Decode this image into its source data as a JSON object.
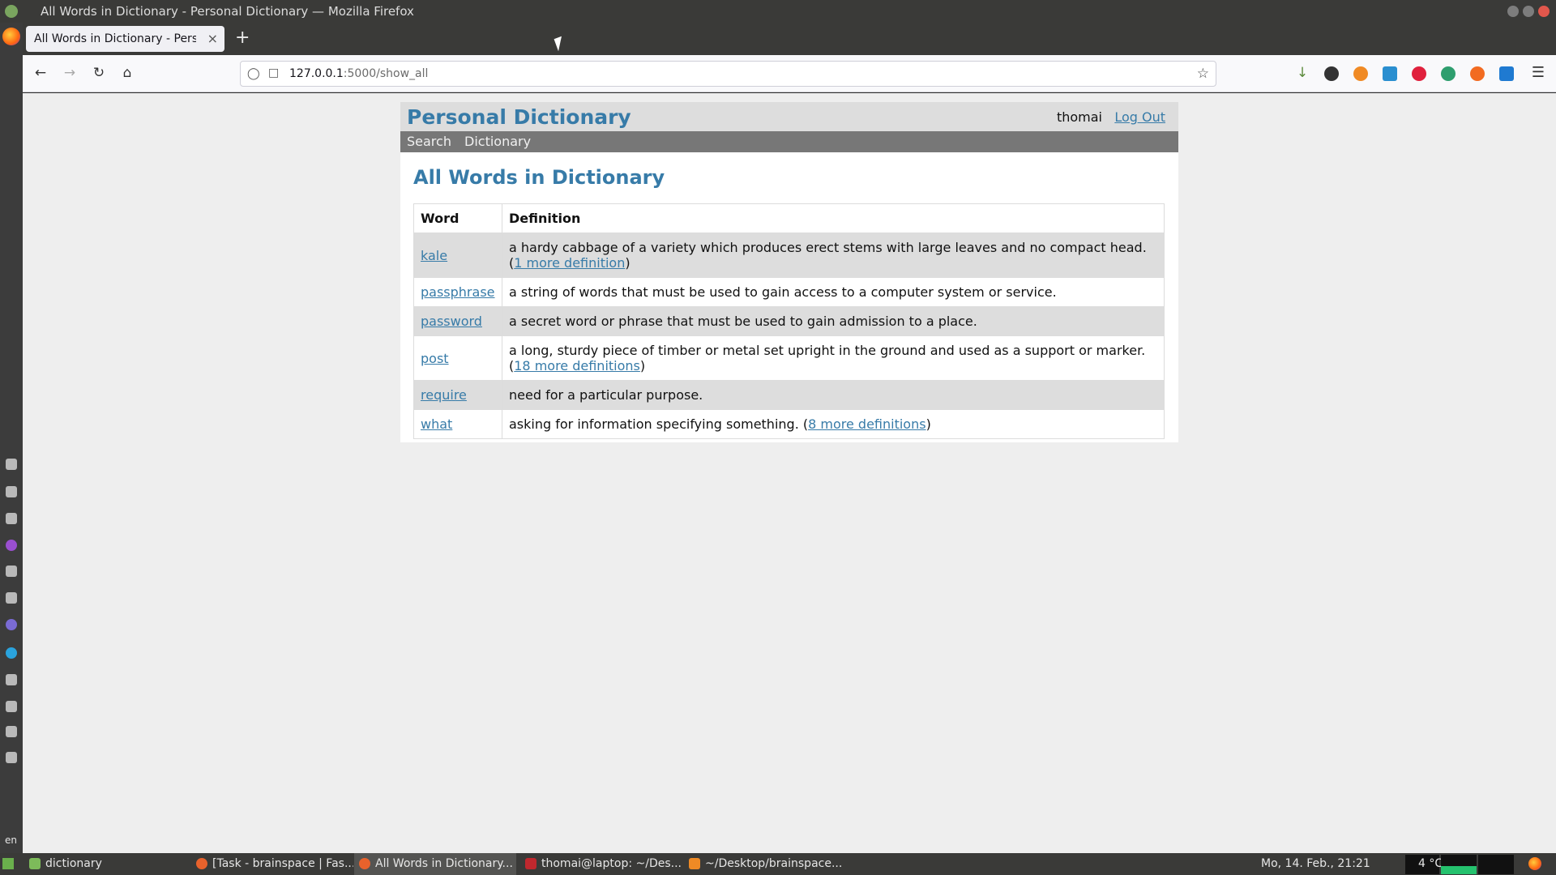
{
  "os": {
    "window_title": "All Words in Dictionary - Personal Dictionary — Mozilla Firefox"
  },
  "browser": {
    "tab_title": "All Words in Dictionary - Personal Dictionary",
    "tab_close": "×",
    "new_tab": "+",
    "url_host": "127.0.0.1",
    "url_rest": ":5000/show_all",
    "icons": [
      "back-icon",
      "forward-icon",
      "reload-icon",
      "home-icon",
      "shield-icon",
      "page-icon",
      "star-icon",
      "download-icon",
      "menu-icon"
    ]
  },
  "site": {
    "title": "Personal Dictionary",
    "username": "thomai",
    "logout_label": "Log Out",
    "nav": {
      "search": "Search",
      "dictionary": "Dictionary"
    }
  },
  "main": {
    "heading": "All Words in Dictionary",
    "columns": {
      "word": "Word",
      "definition": "Definition"
    },
    "rows": [
      {
        "word": "kale",
        "definition": "a hardy cabbage of a variety which produces erect stems with large leaves and no compact head.",
        "more": "1 more definition"
      },
      {
        "word": "passphrase",
        "definition": "a string of words that must be used to gain access to a computer system or service.",
        "more": ""
      },
      {
        "word": "password",
        "definition": "a secret word or phrase that must be used to gain admission to a place.",
        "more": ""
      },
      {
        "word": "post",
        "definition": "a long, sturdy piece of timber or metal set upright in the ground and used as a support or marker.",
        "more": "18 more definitions"
      },
      {
        "word": "require",
        "definition": "need for a particular purpose.",
        "more": ""
      },
      {
        "word": "what",
        "definition": "asking for information specifying something.",
        "more": "8 more definitions"
      }
    ]
  },
  "taskbar": {
    "items": [
      {
        "label": "dictionary"
      },
      {
        "label": "[Task - brainspace | Fas..."
      },
      {
        "label": "All Words in Dictionary..."
      },
      {
        "label": "thomai@laptop: ~/Des..."
      },
      {
        "label": "~/Desktop/brainspace..."
      }
    ],
    "clock": "Mo, 14. Feb., 21:21",
    "weather": "4 °C",
    "lang": "en"
  },
  "colors": {
    "accent": "#377ba8",
    "header_bg": "#dddddd",
    "nav_bg": "#777777",
    "page_bg": "#eeeeee"
  }
}
